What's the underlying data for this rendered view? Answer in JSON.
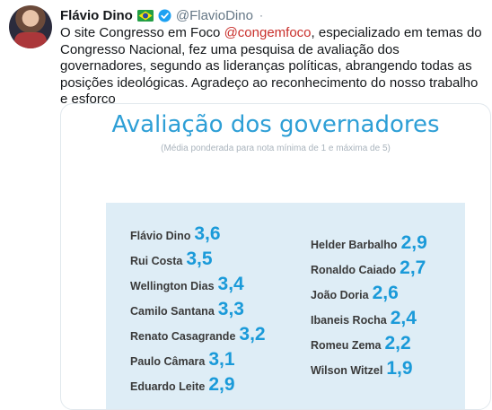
{
  "tweet": {
    "author_name": "Flávio Dino",
    "author_handle": "@FlavioDino",
    "caret": "·",
    "text_before": "O site Congresso em Foco ",
    "mention": "@congemfoco",
    "text_after": ", especializado em temas do Congresso Nacional, fez uma pesquisa de avaliação dos governadores, segundo as lideranças políticas, abrangendo todas as posições ideológicas. Agradeço ao reconhecimento do nosso trabalho e esforço"
  },
  "icons": [
    "avatar",
    "brazil-flag-icon",
    "verified-badge-icon"
  ],
  "colors": {
    "title": "#2e9fd6",
    "score": "#1a9ad9",
    "panel": "#deedf6",
    "mention": "#c9302c"
  },
  "chart_data": {
    "type": "table",
    "title": "Avaliação dos governadores",
    "subtitle": "(Média ponderada para nota mínima de 1 e máxima de 5)",
    "left_column": [
      {
        "name": "Flávio Dino",
        "score": "3,6"
      },
      {
        "name": "Rui Costa",
        "score": "3,5"
      },
      {
        "name": "Wellington Dias",
        "score": "3,4"
      },
      {
        "name": "Camilo Santana",
        "score": "3,3"
      },
      {
        "name": "Renato Casagrande",
        "score": "3,2"
      },
      {
        "name": "Paulo Câmara",
        "score": "3,1"
      },
      {
        "name": "Eduardo Leite",
        "score": "2,9"
      }
    ],
    "right_column": [
      {
        "name": "Helder Barbalho",
        "score": "2,9"
      },
      {
        "name": "Ronaldo Caiado",
        "score": "2,7"
      },
      {
        "name": "João Doria",
        "score": "2,6"
      },
      {
        "name": "Ibaneis Rocha",
        "score": "2,4"
      },
      {
        "name": "Romeu Zema",
        "score": "2,2"
      },
      {
        "name": "Wilson Witzel",
        "score": "1,9"
      }
    ]
  }
}
